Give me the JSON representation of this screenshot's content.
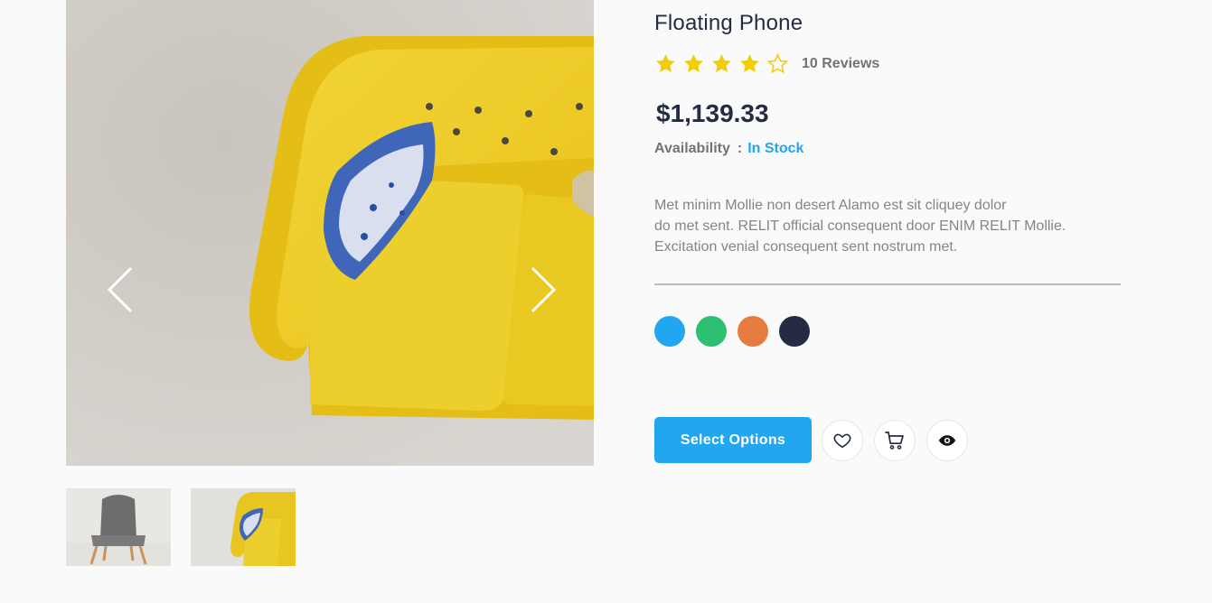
{
  "gallery": {
    "main_image": "yellow-sofa-with-pillow-photo",
    "prev_icon": "chevron-left-icon",
    "next_icon": "chevron-right-icon",
    "thumbnails": [
      {
        "image": "grey-chair-photo"
      },
      {
        "image": "yellow-sofa-photo"
      }
    ]
  },
  "product": {
    "title": "Floating Phone",
    "rating": {
      "value": 4,
      "max": 5
    },
    "reviews": "10 Reviews",
    "price": "$1,139.33",
    "availability_label": "Availability",
    "availability_sep": ":",
    "availability_value": "In Stock",
    "description": [
      "Met minim Mollie non desert Alamo est sit cliquey dolor",
      "do met sent. RELIT official consequent door ENIM RELIT Mollie.",
      "Excitation venial consequent sent nostrum met."
    ],
    "colors": [
      "#23a6f0",
      "#2dc071",
      "#e77c40",
      "#252b42"
    ]
  },
  "actions": {
    "select_options": "Select Options",
    "wishlist_icon": "heart-icon",
    "cart_icon": "cart-icon",
    "view_icon": "eye-icon"
  },
  "theme": {
    "accent": "#23a6f0",
    "star": "#f3cd03",
    "heading": "#252b42"
  }
}
